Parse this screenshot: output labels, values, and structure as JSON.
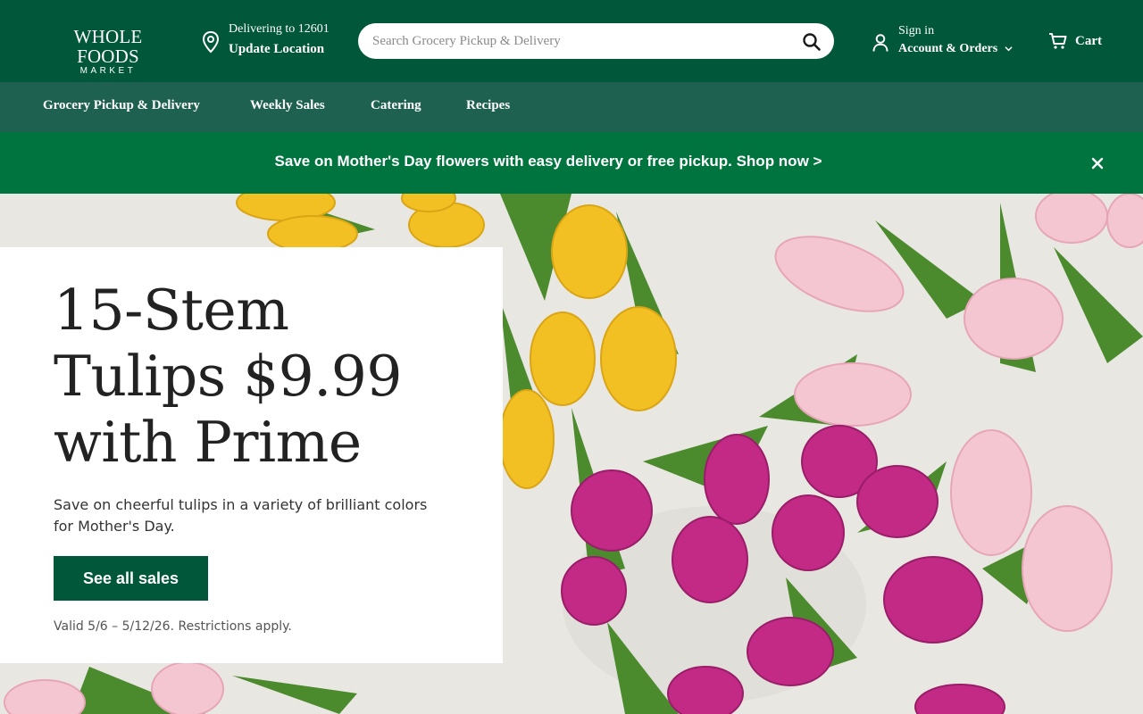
{
  "header": {
    "logo_line1": "WHOLE FOODS",
    "logo_line2": "MARKET",
    "delivering_to": "Delivering to 12601",
    "update_location": "Update Location",
    "search_placeholder": "Search Grocery Pickup & Delivery",
    "sign_in": "Sign in",
    "account_orders": "Account & Orders",
    "cart": "Cart"
  },
  "nav": {
    "items": [
      {
        "label": "Grocery Pickup & Delivery"
      },
      {
        "label": "Weekly Sales"
      },
      {
        "label": "Catering"
      },
      {
        "label": "Recipes"
      }
    ]
  },
  "promo": {
    "message": "Save on Mother's Day flowers with easy delivery or free pickup. Shop now >"
  },
  "hero": {
    "headline": "15-Stem Tulips $9.99 with Prime",
    "description": "Save on cheerful tulips in a variety of brilliant colors for Mother's Day.",
    "button": "See all sales",
    "valid": "Valid 5/6 – 5/12/26. Restrictions apply."
  },
  "colors": {
    "header_bg": "#00573a",
    "subnav_bg": "#1f6150",
    "promo_bg": "#00743f",
    "button_bg": "#00573a"
  }
}
